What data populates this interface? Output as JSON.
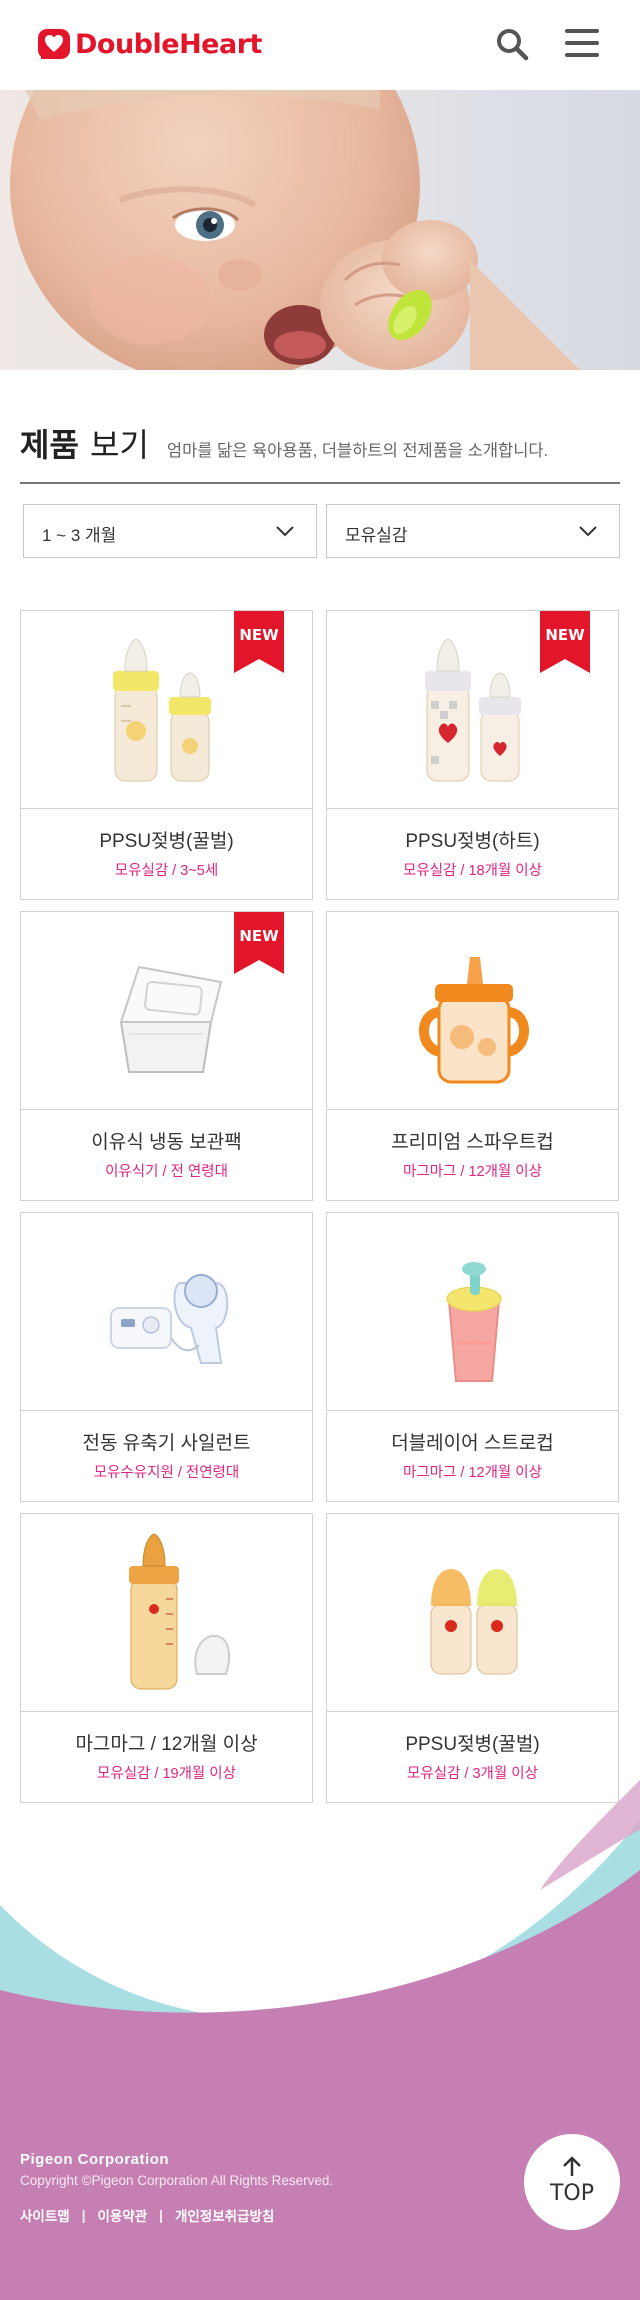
{
  "header": {
    "logo_text": "DoubleHeart"
  },
  "page": {
    "title_bold": "제품",
    "title_light": "보기",
    "description": "엄마를 닮은 육아용품, 더블하트의 전제품을 소개합니다."
  },
  "filters": {
    "age": "1 ~ 3 개월",
    "category": "모유실감"
  },
  "badge_label": "NEW",
  "products": [
    {
      "name": "PPSU젖병(꿀벌)",
      "category": "모유실감 / 3~5세",
      "is_new": true
    },
    {
      "name": "PPSU젖병(하트)",
      "category": "모유실감 / 18개월 이상",
      "is_new": true
    },
    {
      "name": "이유식 냉동 보관팩",
      "category": "이유식기 / 전 연령대",
      "is_new": true
    },
    {
      "name": "프리미엄 스파우트컵",
      "category": "마그마그 / 12개월 이상",
      "is_new": false
    },
    {
      "name": "전동 유축기 사일런트",
      "category": "모유수유지원 / 전연령대",
      "is_new": false
    },
    {
      "name": "더블레이어 스트로컵",
      "category": "마그마그 / 12개월 이상",
      "is_new": false
    },
    {
      "name": "마그마그 / 12개월 이상",
      "category": "모유실감 / 19개월 이상",
      "is_new": false
    },
    {
      "name": "PPSU젖병(꿀벌)",
      "category": "모유실감 / 3개월 이상",
      "is_new": false
    }
  ],
  "footer": {
    "company": "Pigeon Corporation",
    "copyright": "Copyright ©Pigeon Corporation All Rights Reserved.",
    "links": [
      "사이트맵",
      "이용약관",
      "개인정보취급방침"
    ],
    "top_label": "TOP"
  },
  "colors": {
    "brand_red": "#e3152a",
    "accent_pink": "#e02583",
    "footer_purple": "#c67fb2",
    "footer_teal": "#a9dfe3"
  },
  "icons": [
    "search-icon",
    "menu-icon",
    "chevron-down-icon",
    "arrow-up-icon",
    "logo-heart-icon"
  ]
}
